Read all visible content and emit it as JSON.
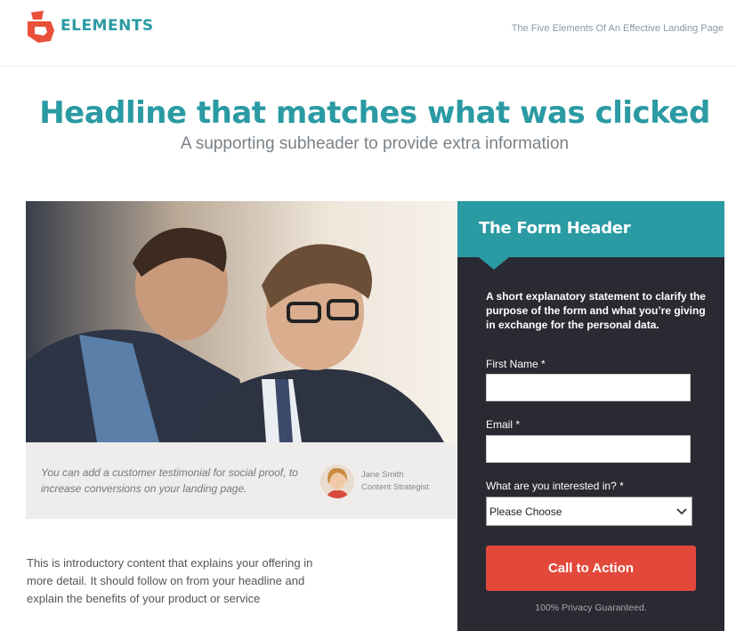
{
  "header": {
    "logo_text": "ELEMENTS",
    "tagline": "The Five Elements Of An Effective Landing Page",
    "logo_icon": "elements-logo-icon"
  },
  "hero": {
    "headline": "Headline that matches what was clicked",
    "subheader": "A supporting subheader to provide extra information"
  },
  "testimonial": {
    "text": "You can add a customer testimonial for social proof, to increase conversions on your landing page.",
    "name": "Jane Smith",
    "role": "Content Strategist"
  },
  "intro": {
    "text": "This is introductory content that explains your offering in more detail. It should follow on from your headline and explain the benefits of your product or service"
  },
  "form": {
    "title": "The Form Header",
    "description": "A short explanatory statement to clarify the purpose of the form and what you’re giving in exchange for the personal data.",
    "first_name_label": "First Name *",
    "first_name_value": "",
    "email_label": "Email *",
    "email_value": "",
    "interest_label": "What are you interested in? *",
    "interest_selected": "Please Choose",
    "cta_label": "Call to Action",
    "privacy": "100% Privacy Guaranteed."
  },
  "colors": {
    "brand_teal": "#2a9aa3",
    "form_bg": "#2a2a33",
    "cta_red": "#e2493b"
  }
}
